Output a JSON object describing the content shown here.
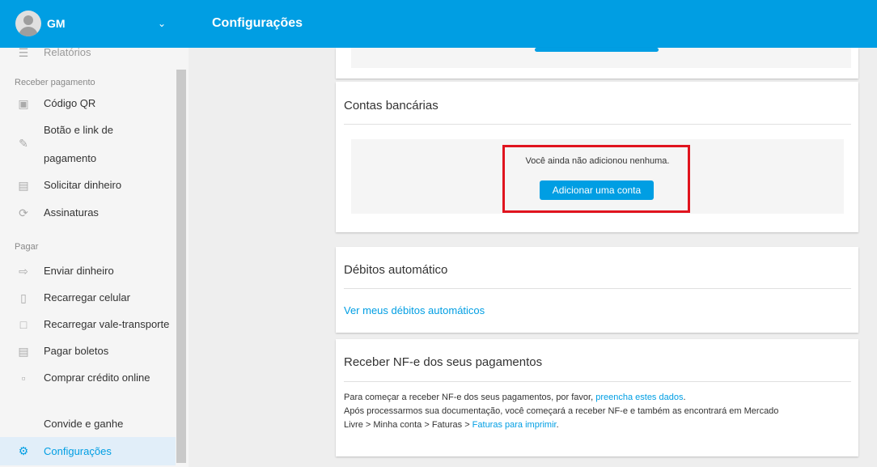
{
  "header": {
    "user_initials": "GM",
    "page_title": "Configurações"
  },
  "sidebar": {
    "partial_item": "Relatórios",
    "section_receive": "Receber pagamento",
    "section_pay": "Pagar",
    "items": [
      {
        "label": "Código QR",
        "icon": "qr-code-icon"
      },
      {
        "label_line1": "Botão e link de",
        "label_line2": "pagamento",
        "icon": "link-icon"
      },
      {
        "label": "Solicitar dinheiro",
        "icon": "request-money-icon"
      },
      {
        "label": "Assinaturas",
        "icon": "subscription-icon"
      },
      {
        "label": "Enviar dinheiro",
        "icon": "send-money-icon"
      },
      {
        "label": "Recarregar celular",
        "icon": "phone-recharge-icon"
      },
      {
        "label": "Recarregar vale-transporte",
        "icon": "transport-card-icon"
      },
      {
        "label": "Pagar boletos",
        "icon": "boleto-icon"
      },
      {
        "label": "Comprar crédito online",
        "icon": "credit-card-icon"
      },
      {
        "label": "Convide e ganhe",
        "icon": ""
      },
      {
        "label": "Configurações",
        "icon": "gear-icon",
        "active": true
      }
    ]
  },
  "bank_accounts": {
    "title": "Contas bancárias",
    "empty_message": "Você ainda não adicionou nenhuma.",
    "add_button": "Adicionar uma conta"
  },
  "auto_debits": {
    "title": "Débitos automático",
    "link": "Ver meus débitos automáticos"
  },
  "nfe": {
    "title": "Receber NF-e dos seus pagamentos",
    "line1_prefix": "Para começar a receber NF-e dos seus pagamentos, por favor, ",
    "line1_link": "preencha estes dados",
    "line1_suffix": ".",
    "line2": "Após processarmos sua documentação, você começará a receber NF-e e também as encontrará em Mercado",
    "line3_prefix": "Livre > Minha conta > Faturas > ",
    "line3_link": "Faturas para imprimir",
    "line3_suffix": "."
  },
  "colors": {
    "brand_blue": "#009ee3",
    "highlight_red": "#e0141e"
  }
}
